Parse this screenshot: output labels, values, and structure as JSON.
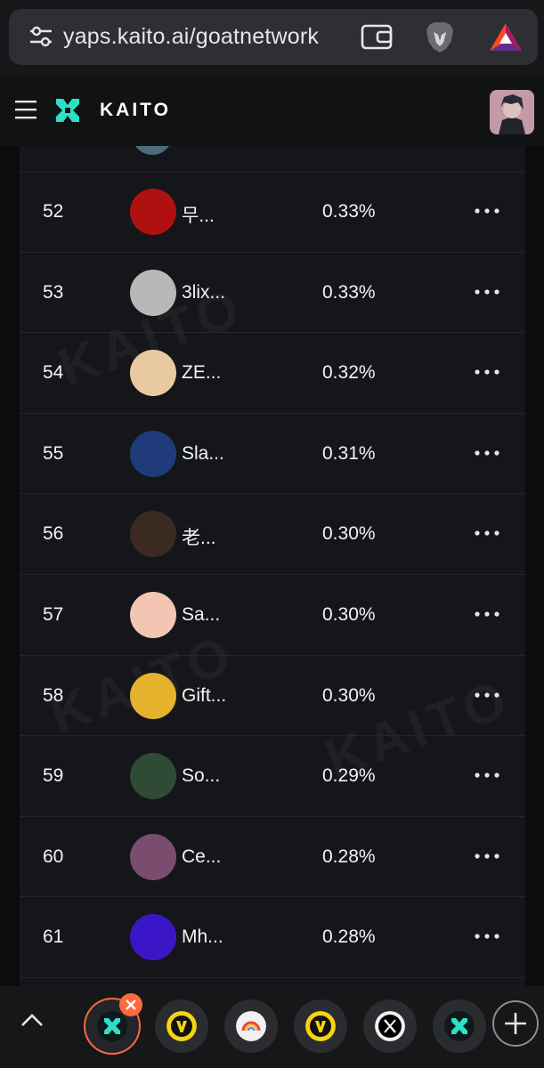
{
  "browser": {
    "url": "yaps.kaito.ai/goatnetwork",
    "icons": [
      "tune-icon",
      "wallet-icon",
      "brave-lion-icon",
      "bat-rewards-icon"
    ]
  },
  "header": {
    "brand": "KAITO",
    "accent_color": "#2de0c6"
  },
  "watermark_text": "KAITO",
  "leaderboard": {
    "rows": [
      {
        "rank": "52",
        "name": "무...",
        "share": "0.33%",
        "avatar_color": "#b01010"
      },
      {
        "rank": "53",
        "name": "3lix...",
        "share": "0.33%",
        "avatar_color": "#b8b8b8"
      },
      {
        "rank": "54",
        "name": "ZE...",
        "share": "0.32%",
        "avatar_color": "#e9c9a0"
      },
      {
        "rank": "55",
        "name": "Sla...",
        "share": "0.31%",
        "avatar_color": "#1f3b7a"
      },
      {
        "rank": "56",
        "name": "老...",
        "share": "0.30%",
        "avatar_color": "#3a2a22"
      },
      {
        "rank": "57",
        "name": "Sa...",
        "share": "0.30%",
        "avatar_color": "#f3c6b4"
      },
      {
        "rank": "58",
        "name": "Gift...",
        "share": "0.30%",
        "avatar_color": "#e6b12c"
      },
      {
        "rank": "59",
        "name": "So...",
        "share": "0.29%",
        "avatar_color": "#2f4a35"
      },
      {
        "rank": "60",
        "name": "Ce...",
        "share": "0.28%",
        "avatar_color": "#7a4d6e"
      },
      {
        "rank": "61",
        "name": "Mh...",
        "share": "0.28%",
        "avatar_color": "#3b16c9"
      }
    ]
  },
  "tabstrip": {
    "tabs": [
      {
        "icon": "kaito-icon",
        "active": true
      },
      {
        "icon": "v-logo-icon",
        "active": false
      },
      {
        "icon": "chrome-web-icon",
        "active": false
      },
      {
        "icon": "v-logo-icon",
        "active": false
      },
      {
        "icon": "x-icon",
        "active": false
      },
      {
        "icon": "kaito-icon",
        "active": false
      }
    ]
  }
}
